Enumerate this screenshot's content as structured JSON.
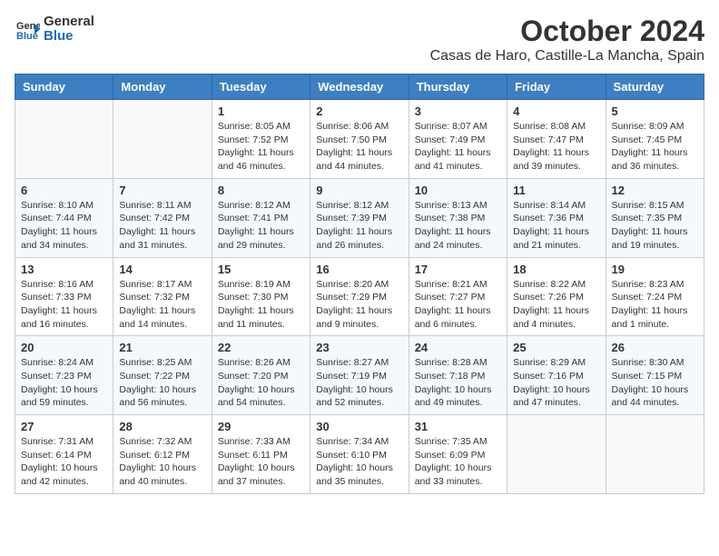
{
  "header": {
    "logo_general": "General",
    "logo_blue": "Blue",
    "title": "October 2024",
    "subtitle": "Casas de Haro, Castille-La Mancha, Spain"
  },
  "weekdays": [
    "Sunday",
    "Monday",
    "Tuesday",
    "Wednesday",
    "Thursday",
    "Friday",
    "Saturday"
  ],
  "weeks": [
    [
      {
        "day": "",
        "info": ""
      },
      {
        "day": "",
        "info": ""
      },
      {
        "day": "1",
        "info": "Sunrise: 8:05 AM\nSunset: 7:52 PM\nDaylight: 11 hours and 46 minutes."
      },
      {
        "day": "2",
        "info": "Sunrise: 8:06 AM\nSunset: 7:50 PM\nDaylight: 11 hours and 44 minutes."
      },
      {
        "day": "3",
        "info": "Sunrise: 8:07 AM\nSunset: 7:49 PM\nDaylight: 11 hours and 41 minutes."
      },
      {
        "day": "4",
        "info": "Sunrise: 8:08 AM\nSunset: 7:47 PM\nDaylight: 11 hours and 39 minutes."
      },
      {
        "day": "5",
        "info": "Sunrise: 8:09 AM\nSunset: 7:45 PM\nDaylight: 11 hours and 36 minutes."
      }
    ],
    [
      {
        "day": "6",
        "info": "Sunrise: 8:10 AM\nSunset: 7:44 PM\nDaylight: 11 hours and 34 minutes."
      },
      {
        "day": "7",
        "info": "Sunrise: 8:11 AM\nSunset: 7:42 PM\nDaylight: 11 hours and 31 minutes."
      },
      {
        "day": "8",
        "info": "Sunrise: 8:12 AM\nSunset: 7:41 PM\nDaylight: 11 hours and 29 minutes."
      },
      {
        "day": "9",
        "info": "Sunrise: 8:12 AM\nSunset: 7:39 PM\nDaylight: 11 hours and 26 minutes."
      },
      {
        "day": "10",
        "info": "Sunrise: 8:13 AM\nSunset: 7:38 PM\nDaylight: 11 hours and 24 minutes."
      },
      {
        "day": "11",
        "info": "Sunrise: 8:14 AM\nSunset: 7:36 PM\nDaylight: 11 hours and 21 minutes."
      },
      {
        "day": "12",
        "info": "Sunrise: 8:15 AM\nSunset: 7:35 PM\nDaylight: 11 hours and 19 minutes."
      }
    ],
    [
      {
        "day": "13",
        "info": "Sunrise: 8:16 AM\nSunset: 7:33 PM\nDaylight: 11 hours and 16 minutes."
      },
      {
        "day": "14",
        "info": "Sunrise: 8:17 AM\nSunset: 7:32 PM\nDaylight: 11 hours and 14 minutes."
      },
      {
        "day": "15",
        "info": "Sunrise: 8:19 AM\nSunset: 7:30 PM\nDaylight: 11 hours and 11 minutes."
      },
      {
        "day": "16",
        "info": "Sunrise: 8:20 AM\nSunset: 7:29 PM\nDaylight: 11 hours and 9 minutes."
      },
      {
        "day": "17",
        "info": "Sunrise: 8:21 AM\nSunset: 7:27 PM\nDaylight: 11 hours and 6 minutes."
      },
      {
        "day": "18",
        "info": "Sunrise: 8:22 AM\nSunset: 7:26 PM\nDaylight: 11 hours and 4 minutes."
      },
      {
        "day": "19",
        "info": "Sunrise: 8:23 AM\nSunset: 7:24 PM\nDaylight: 11 hours and 1 minute."
      }
    ],
    [
      {
        "day": "20",
        "info": "Sunrise: 8:24 AM\nSunset: 7:23 PM\nDaylight: 10 hours and 59 minutes."
      },
      {
        "day": "21",
        "info": "Sunrise: 8:25 AM\nSunset: 7:22 PM\nDaylight: 10 hours and 56 minutes."
      },
      {
        "day": "22",
        "info": "Sunrise: 8:26 AM\nSunset: 7:20 PM\nDaylight: 10 hours and 54 minutes."
      },
      {
        "day": "23",
        "info": "Sunrise: 8:27 AM\nSunset: 7:19 PM\nDaylight: 10 hours and 52 minutes."
      },
      {
        "day": "24",
        "info": "Sunrise: 8:28 AM\nSunset: 7:18 PM\nDaylight: 10 hours and 49 minutes."
      },
      {
        "day": "25",
        "info": "Sunrise: 8:29 AM\nSunset: 7:16 PM\nDaylight: 10 hours and 47 minutes."
      },
      {
        "day": "26",
        "info": "Sunrise: 8:30 AM\nSunset: 7:15 PM\nDaylight: 10 hours and 44 minutes."
      }
    ],
    [
      {
        "day": "27",
        "info": "Sunrise: 7:31 AM\nSunset: 6:14 PM\nDaylight: 10 hours and 42 minutes."
      },
      {
        "day": "28",
        "info": "Sunrise: 7:32 AM\nSunset: 6:12 PM\nDaylight: 10 hours and 40 minutes."
      },
      {
        "day": "29",
        "info": "Sunrise: 7:33 AM\nSunset: 6:11 PM\nDaylight: 10 hours and 37 minutes."
      },
      {
        "day": "30",
        "info": "Sunrise: 7:34 AM\nSunset: 6:10 PM\nDaylight: 10 hours and 35 minutes."
      },
      {
        "day": "31",
        "info": "Sunrise: 7:35 AM\nSunset: 6:09 PM\nDaylight: 10 hours and 33 minutes."
      },
      {
        "day": "",
        "info": ""
      },
      {
        "day": "",
        "info": ""
      }
    ]
  ]
}
